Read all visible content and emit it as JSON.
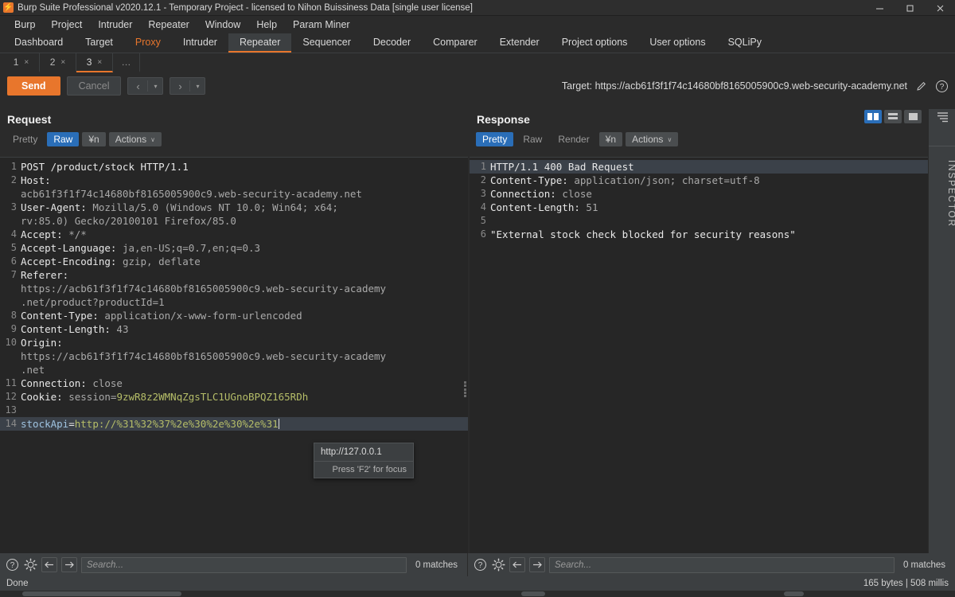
{
  "titlebar": {
    "title": "Burp Suite Professional v2020.12.1 - Temporary Project - licensed to Nihon Buissiness Data [single user license]",
    "logo_glyph": "⚡",
    "minimize": "—",
    "maximize": "❐",
    "close": "✕"
  },
  "menubar": {
    "items": [
      {
        "label": "Burp"
      },
      {
        "label": "Project"
      },
      {
        "label": "Intruder"
      },
      {
        "label": "Repeater"
      },
      {
        "label": "Window"
      },
      {
        "label": "Help"
      },
      {
        "label": "Param Miner"
      }
    ]
  },
  "maintabs": {
    "items": [
      {
        "label": "Dashboard",
        "state": "normal"
      },
      {
        "label": "Target",
        "state": "normal"
      },
      {
        "label": "Proxy",
        "state": "highlight"
      },
      {
        "label": "Intruder",
        "state": "normal"
      },
      {
        "label": "Repeater",
        "state": "active"
      },
      {
        "label": "Sequencer",
        "state": "normal"
      },
      {
        "label": "Decoder",
        "state": "normal"
      },
      {
        "label": "Comparer",
        "state": "normal"
      },
      {
        "label": "Extender",
        "state": "normal"
      },
      {
        "label": "Project options",
        "state": "normal"
      },
      {
        "label": "User options",
        "state": "normal"
      },
      {
        "label": "SQLiPy",
        "state": "normal"
      }
    ]
  },
  "subtabs": {
    "items": [
      {
        "label": "1",
        "close": "×",
        "active": false
      },
      {
        "label": "2",
        "close": "×",
        "active": false
      },
      {
        "label": "3",
        "close": "×",
        "active": true
      }
    ],
    "overflow": "…"
  },
  "toolbar": {
    "send_label": "Send",
    "cancel_label": "Cancel",
    "back_glyph": "‹",
    "forward_glyph": "›",
    "dropdown_glyph": "▾",
    "target_label": "Target: https://acb61f3f1f74c14680bf8165005900c9.web-security-academy.net",
    "edit_icon": "pencil-icon",
    "help_icon": "question-icon"
  },
  "layout": {
    "toggles": [
      {
        "name": "side-by-side",
        "on": true
      },
      {
        "name": "stacked",
        "on": false
      },
      {
        "name": "single",
        "on": false
      }
    ],
    "inspector_label": "INSPECTOR"
  },
  "request": {
    "title": "Request",
    "tabs": [
      {
        "label": "Pretty",
        "state": "dim"
      },
      {
        "label": "Raw",
        "state": "selected"
      },
      {
        "label": "¥n",
        "state": "box"
      },
      {
        "label": "Actions",
        "state": "actions",
        "caret": "∨"
      }
    ],
    "lines": [
      {
        "n": "1",
        "segments": [
          {
            "t": "POST /product/stock HTTP/1.1",
            "c": "hdr-name"
          }
        ]
      },
      {
        "n": "2",
        "segments": [
          {
            "t": "Host: ",
            "c": "hdr-name"
          }
        ]
      },
      {
        "n": "",
        "cont": true,
        "segments": [
          {
            "t": "acb61f3f1f74c14680bf8165005900c9.web-security-academy.net",
            "c": "hdr-val"
          }
        ]
      },
      {
        "n": "3",
        "segments": [
          {
            "t": "User-Agent: ",
            "c": "hdr-name"
          },
          {
            "t": "Mozilla/5.0 (Windows NT 10.0; Win64; x64;",
            "c": "hdr-val"
          }
        ]
      },
      {
        "n": "",
        "cont": true,
        "segments": [
          {
            "t": "rv:85.0) Gecko/20100101 Firefox/85.0",
            "c": "hdr-val"
          }
        ]
      },
      {
        "n": "4",
        "segments": [
          {
            "t": "Accept: ",
            "c": "hdr-name"
          },
          {
            "t": "*/*",
            "c": "hdr-val"
          }
        ]
      },
      {
        "n": "5",
        "segments": [
          {
            "t": "Accept-Language: ",
            "c": "hdr-name"
          },
          {
            "t": "ja,en-US;q=0.7,en;q=0.3",
            "c": "hdr-val"
          }
        ]
      },
      {
        "n": "6",
        "segments": [
          {
            "t": "Accept-Encoding: ",
            "c": "hdr-name"
          },
          {
            "t": "gzip, deflate",
            "c": "hdr-val"
          }
        ]
      },
      {
        "n": "7",
        "segments": [
          {
            "t": "Referer: ",
            "c": "hdr-name"
          }
        ]
      },
      {
        "n": "",
        "cont": true,
        "segments": [
          {
            "t": "https://acb61f3f1f74c14680bf8165005900c9.web-security-academy",
            "c": "hdr-val"
          }
        ]
      },
      {
        "n": "",
        "cont": true,
        "segments": [
          {
            "t": ".net/product?productId=1",
            "c": "hdr-val"
          }
        ]
      },
      {
        "n": "8",
        "segments": [
          {
            "t": "Content-Type: ",
            "c": "hdr-name"
          },
          {
            "t": "application/x-www-form-urlencoded",
            "c": "hdr-val"
          }
        ]
      },
      {
        "n": "9",
        "segments": [
          {
            "t": "Content-Length: ",
            "c": "hdr-name"
          },
          {
            "t": "43",
            "c": "hdr-val"
          }
        ]
      },
      {
        "n": "10",
        "segments": [
          {
            "t": "Origin: ",
            "c": "hdr-name"
          }
        ]
      },
      {
        "n": "",
        "cont": true,
        "segments": [
          {
            "t": "https://acb61f3f1f74c14680bf8165005900c9.web-security-academy",
            "c": "hdr-val"
          }
        ]
      },
      {
        "n": "",
        "cont": true,
        "segments": [
          {
            "t": ".net",
            "c": "hdr-val"
          }
        ]
      },
      {
        "n": "11",
        "segments": [
          {
            "t": "Connection: ",
            "c": "hdr-name"
          },
          {
            "t": "close",
            "c": "hdr-val"
          }
        ]
      },
      {
        "n": "12",
        "segments": [
          {
            "t": "Cookie: ",
            "c": "hdr-name"
          },
          {
            "t": "session=",
            "c": "hdr-val"
          },
          {
            "t": "9zwR8z2WMNqZgsTLC1UGnoBPQZ165RDh",
            "c": "cookie-val"
          }
        ]
      },
      {
        "n": "13",
        "segments": [
          {
            "t": "",
            "c": "hdr-val"
          }
        ]
      },
      {
        "n": "14",
        "selected": true,
        "caret": true,
        "segments": [
          {
            "t": "stockApi",
            "c": "param-name"
          },
          {
            "t": "=",
            "c": "hdr-name"
          },
          {
            "t": "http://%31%32%37%2e%30%2e%30%2e%31",
            "c": "param-val"
          }
        ]
      }
    ],
    "autocomplete": {
      "value": "http://127.0.0.1",
      "hint": "Press 'F2' for focus"
    },
    "search": {
      "placeholder": "Search...",
      "matches": "0 matches"
    }
  },
  "response": {
    "title": "Response",
    "tabs": [
      {
        "label": "Pretty",
        "state": "selected"
      },
      {
        "label": "Raw",
        "state": "dim"
      },
      {
        "label": "Render",
        "state": "dim"
      },
      {
        "label": "¥n",
        "state": "box"
      },
      {
        "label": "Actions",
        "state": "actions",
        "caret": "∨"
      }
    ],
    "lines": [
      {
        "n": "1",
        "selected": true,
        "segments": [
          {
            "t": "HTTP/1.1 400 Bad Request",
            "c": "resp-status"
          }
        ]
      },
      {
        "n": "2",
        "segments": [
          {
            "t": "Content-Type: ",
            "c": "hdr-name"
          },
          {
            "t": "application/json; charset=utf-8",
            "c": "hdr-val"
          }
        ]
      },
      {
        "n": "3",
        "segments": [
          {
            "t": "Connection: ",
            "c": "hdr-name"
          },
          {
            "t": "close",
            "c": "hdr-val"
          }
        ]
      },
      {
        "n": "4",
        "segments": [
          {
            "t": "Content-Length: ",
            "c": "hdr-name"
          },
          {
            "t": "51",
            "c": "hdr-val"
          }
        ]
      },
      {
        "n": "5",
        "segments": [
          {
            "t": "",
            "c": "hdr-val"
          }
        ]
      },
      {
        "n": "6",
        "segments": [
          {
            "t": "\"External stock check blocked for security reasons\"",
            "c": "hdr-name"
          }
        ]
      }
    ],
    "search": {
      "placeholder": "Search...",
      "matches": "0 matches"
    }
  },
  "statusbar": {
    "left": "Done",
    "right": "165 bytes | 508 millis"
  },
  "searchbar_icons": {
    "help": "question-icon",
    "settings": "gear-icon",
    "prev": "arrow-left-icon",
    "next": "arrow-right-icon"
  },
  "colors": {
    "accent": "#e8762c",
    "selected_tab": "#2a6eb8",
    "window_bg": "#2b2b2b",
    "editor_bg": "#262626",
    "panel_bg": "#3c3f41",
    "param_value": "#b5bd68",
    "param_name": "#9fc3e0"
  }
}
